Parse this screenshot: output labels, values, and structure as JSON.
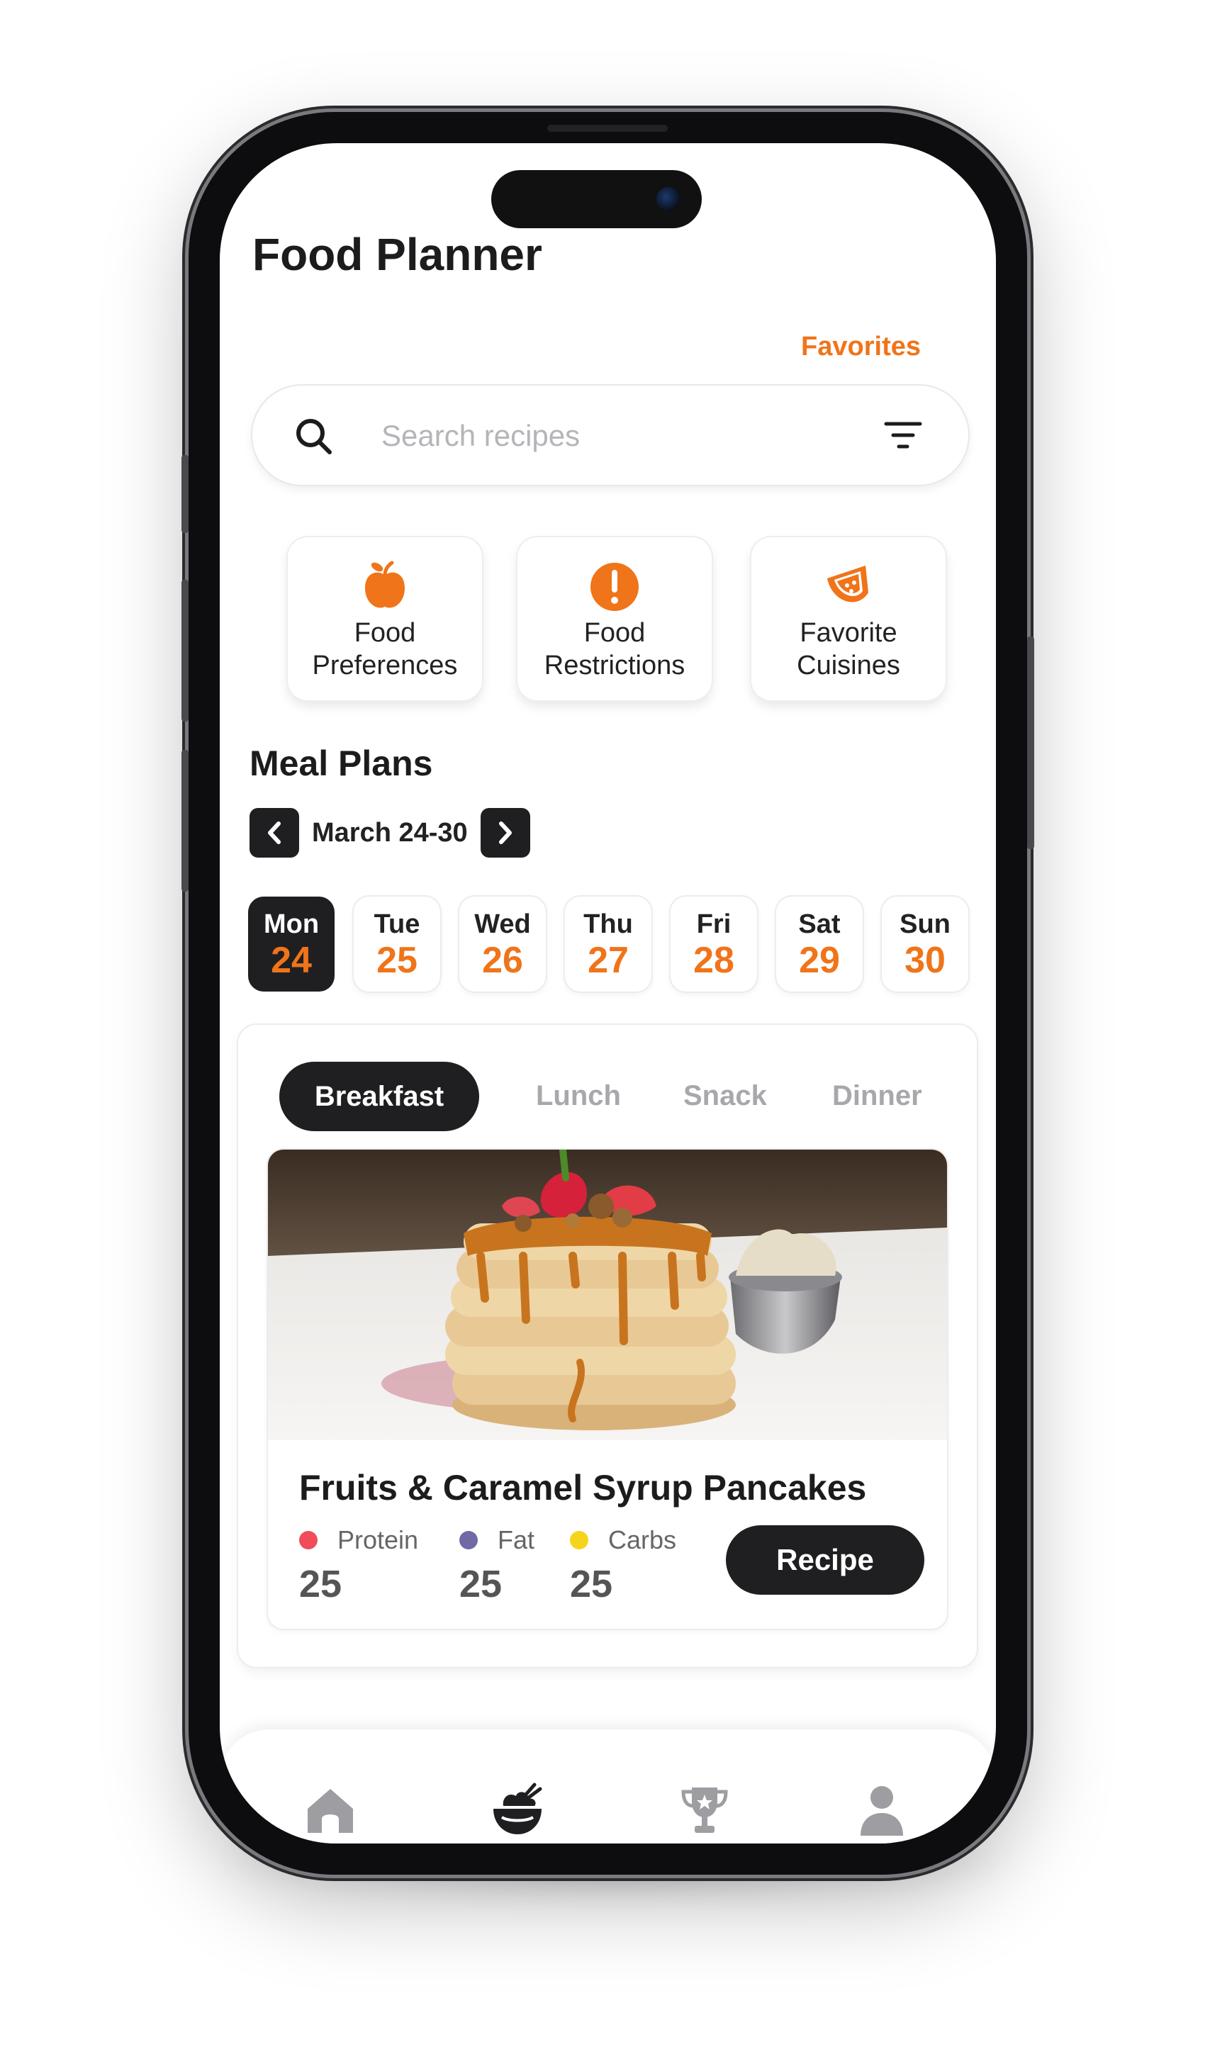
{
  "app": {
    "title": "Food Planner",
    "favorites_link": "Favorites",
    "accent_color": "#f07419",
    "dark_color": "#1f1f22"
  },
  "search": {
    "placeholder": "Search recipes",
    "value": "",
    "icon": "search-icon",
    "filter_icon": "filter-icon"
  },
  "categories": [
    {
      "label": "Food\nPreferences",
      "icon": "apple-icon"
    },
    {
      "label": "Food\nRestrictions",
      "icon": "exclamation-icon"
    },
    {
      "label": "Favorite\nCuisines",
      "icon": "watermelon-icon"
    }
  ],
  "meal_plans": {
    "title": "Meal Plans",
    "week_label": "March 24-30",
    "days": [
      {
        "name": "Mon",
        "num": "24",
        "active": true
      },
      {
        "name": "Tue",
        "num": "25",
        "active": false
      },
      {
        "name": "Wed",
        "num": "26",
        "active": false
      },
      {
        "name": "Thu",
        "num": "27",
        "active": false
      },
      {
        "name": "Fri",
        "num": "28",
        "active": false
      },
      {
        "name": "Sat",
        "num": "29",
        "active": false
      },
      {
        "name": "Sun",
        "num": "30",
        "active": false
      }
    ],
    "tabs": {
      "active": "Breakfast",
      "others": [
        "Lunch",
        "Snack",
        "Dinner"
      ]
    },
    "recipe": {
      "title": "Fruits & Caramel Syrup Pancakes",
      "button_label": "Recipe",
      "macros": [
        {
          "label": "Protein",
          "value": "25",
          "color": "#f04c5a"
        },
        {
          "label": "Fat",
          "value": "25",
          "color": "#6f6aa6"
        },
        {
          "label": "Carbs",
          "value": "25",
          "color": "#f5d51c"
        }
      ]
    }
  },
  "bottom_nav": {
    "items": [
      "home-icon",
      "food-bowl-icon",
      "trophy-icon",
      "profile-icon"
    ],
    "active": "food-bowl-icon"
  }
}
